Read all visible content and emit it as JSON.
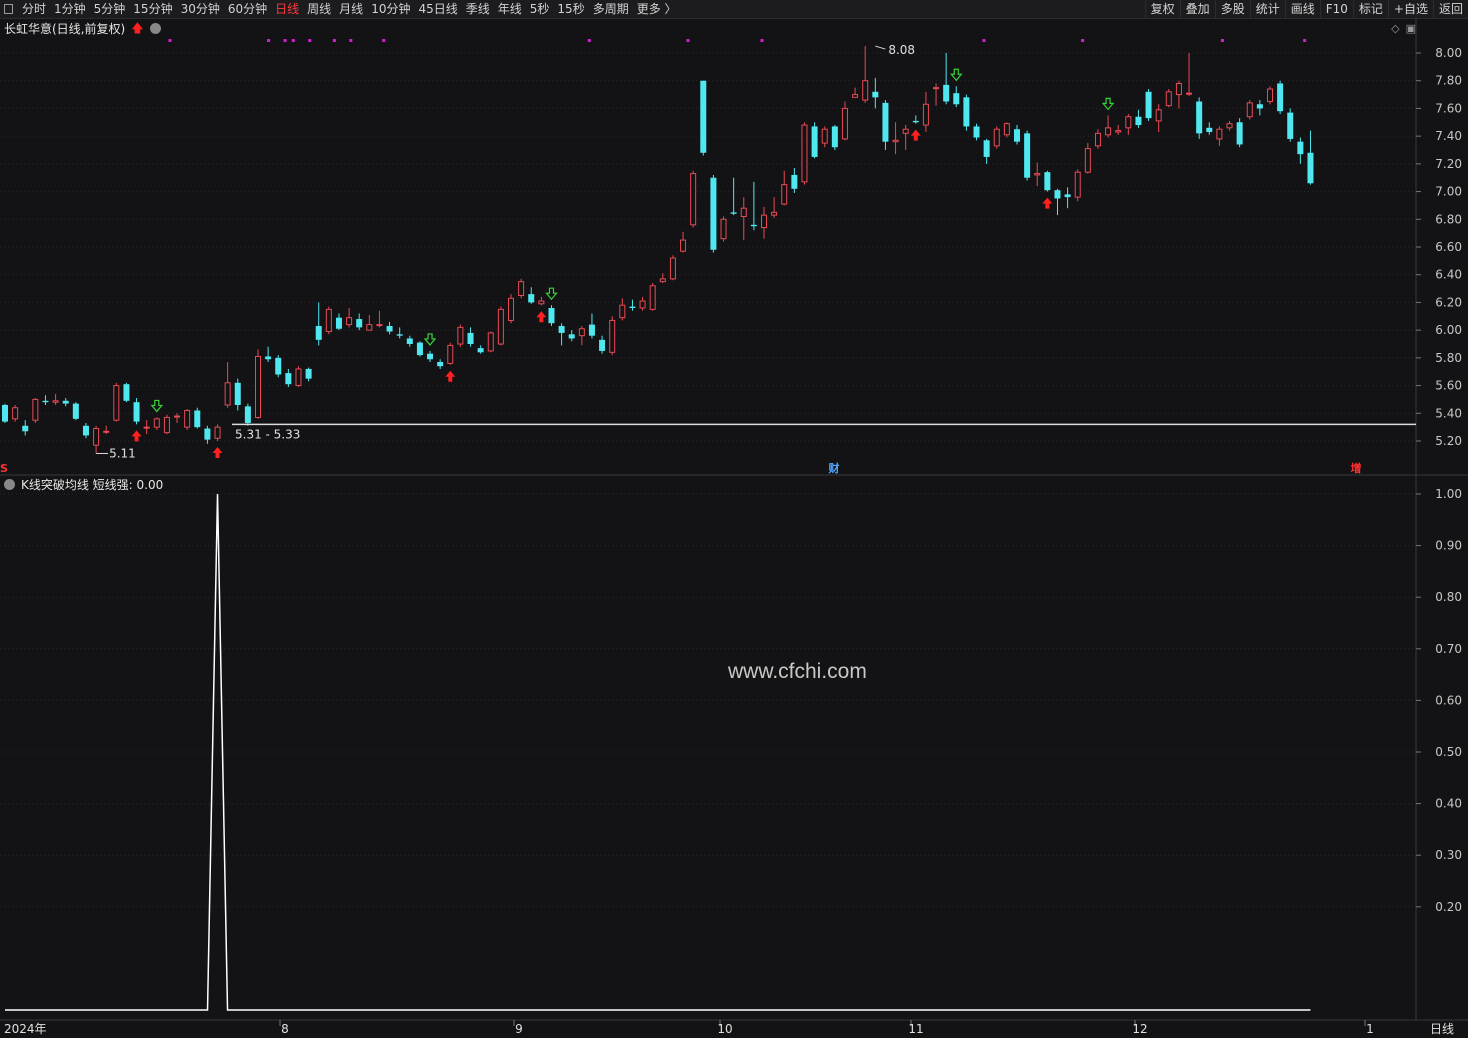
{
  "toolbar": {
    "periods": [
      "分时",
      "1分钟",
      "5分钟",
      "15分钟",
      "30分钟",
      "60分钟",
      "日线",
      "周线",
      "月线",
      "10分钟",
      "45日线",
      "季线",
      "年线",
      "5秒",
      "15秒",
      "多周期",
      "更多 〉"
    ],
    "active_period": "日线",
    "actions": [
      "复权",
      "叠加",
      "多股",
      "统计",
      "画线",
      "F10",
      "标记",
      "+自选",
      "返回"
    ]
  },
  "chart": {
    "title": "长虹华意(日线,前复权)",
    "high_label": "8.08",
    "low_label": "5.11",
    "range_label": "5.31 - 5.33",
    "event_markers": [
      "S",
      "财",
      "增"
    ],
    "price_ticks": [
      "8.00",
      "7.80",
      "7.60",
      "7.40",
      "7.20",
      "7.00",
      "6.80",
      "6.60",
      "6.40",
      "6.20",
      "6.00",
      "5.80",
      "5.60",
      "5.40",
      "5.20"
    ],
    "colors": {
      "up": "#e84a55",
      "down": "#4fe8f0",
      "background": "#131315",
      "grid": "#2a2a2e",
      "buy": "#ff2020",
      "sell": "#3ad23a",
      "dot": "#d020d0"
    }
  },
  "indicator": {
    "title": "K线突破均线 短线强: 0.00",
    "ticks": [
      "1.00",
      "0.90",
      "0.80",
      "0.70",
      "0.60",
      "0.50",
      "0.40",
      "0.30",
      "0.20"
    ]
  },
  "x_axis": {
    "labels": [
      "2024年",
      "8",
      "9",
      "10",
      "11",
      "12",
      "1"
    ],
    "period_label": "日线"
  },
  "watermark": "www.cfchi.com",
  "chart_data": {
    "type": "candlestick",
    "price_range": [
      5.1,
      8.1
    ],
    "candles": [
      [
        5.46,
        5.34,
        5.47,
        5.33
      ],
      [
        5.36,
        5.44,
        5.46,
        5.34
      ],
      [
        5.31,
        5.27,
        5.35,
        5.24
      ],
      [
        5.35,
        5.5,
        5.51,
        5.33
      ],
      [
        5.49,
        5.48,
        5.53,
        5.46
      ],
      [
        5.48,
        5.49,
        5.54,
        5.46
      ],
      [
        5.49,
        5.47,
        5.51,
        5.45
      ],
      [
        5.47,
        5.36,
        5.48,
        5.35
      ],
      [
        5.31,
        5.24,
        5.33,
        5.22
      ],
      [
        5.17,
        5.29,
        5.31,
        5.11
      ],
      [
        5.27,
        5.27,
        5.31,
        5.25
      ],
      [
        5.35,
        5.6,
        5.62,
        5.34
      ],
      [
        5.61,
        5.49,
        5.62,
        5.48
      ],
      [
        5.48,
        5.34,
        5.51,
        5.32
      ],
      [
        5.3,
        5.3,
        5.35,
        5.25
      ],
      [
        5.3,
        5.36,
        5.37,
        5.28
      ],
      [
        5.26,
        5.37,
        5.39,
        5.25
      ],
      [
        5.38,
        5.38,
        5.4,
        5.33
      ],
      [
        5.3,
        5.42,
        5.43,
        5.28
      ],
      [
        5.42,
        5.3,
        5.44,
        5.29
      ],
      [
        5.29,
        5.21,
        5.31,
        5.18
      ],
      [
        5.22,
        5.3,
        5.32,
        5.2
      ],
      [
        5.46,
        5.62,
        5.77,
        5.44
      ],
      [
        5.62,
        5.46,
        5.65,
        5.42
      ],
      [
        5.45,
        5.33,
        5.47,
        5.31
      ],
      [
        5.37,
        5.81,
        5.86,
        5.36
      ],
      [
        5.81,
        5.79,
        5.88,
        5.77
      ],
      [
        5.8,
        5.68,
        5.82,
        5.66
      ],
      [
        5.69,
        5.61,
        5.72,
        5.59
      ],
      [
        5.6,
        5.72,
        5.74,
        5.59
      ],
      [
        5.72,
        5.65,
        5.73,
        5.63
      ],
      [
        6.03,
        5.93,
        6.2,
        5.89
      ],
      [
        5.99,
        6.15,
        6.17,
        5.97
      ],
      [
        6.09,
        6.01,
        6.12,
        6.0
      ],
      [
        6.04,
        6.09,
        6.16,
        6.02
      ],
      [
        6.08,
        6.02,
        6.12,
        6.0
      ],
      [
        6.0,
        6.04,
        6.11,
        6.01
      ],
      [
        6.04,
        6.04,
        6.14,
        6.02
      ],
      [
        6.03,
        5.99,
        6.06,
        5.97
      ],
      [
        5.97,
        5.96,
        6.02,
        5.94
      ],
      [
        5.94,
        5.9,
        5.96,
        5.88
      ],
      [
        5.91,
        5.82,
        5.92,
        5.81
      ],
      [
        5.83,
        5.79,
        5.85,
        5.77
      ],
      [
        5.77,
        5.74,
        5.79,
        5.72
      ],
      [
        5.76,
        5.89,
        5.91,
        5.75
      ],
      [
        5.9,
        6.02,
        6.04,
        5.88
      ],
      [
        5.98,
        5.9,
        6.02,
        5.88
      ],
      [
        5.87,
        5.84,
        5.89,
        5.83
      ],
      [
        5.85,
        5.98,
        5.99,
        5.84
      ],
      [
        5.9,
        6.15,
        6.17,
        5.89
      ],
      [
        6.07,
        6.23,
        6.26,
        6.05
      ],
      [
        6.25,
        6.35,
        6.37,
        6.23
      ],
      [
        6.26,
        6.2,
        6.31,
        6.19
      ],
      [
        6.19,
        6.21,
        6.24,
        6.18
      ],
      [
        6.16,
        6.05,
        6.18,
        6.03
      ],
      [
        6.03,
        5.98,
        6.05,
        5.89
      ],
      [
        5.97,
        5.94,
        6.0,
        5.92
      ],
      [
        5.96,
        6.01,
        6.03,
        5.89
      ],
      [
        6.04,
        5.96,
        6.12,
        5.94
      ],
      [
        5.93,
        5.85,
        5.96,
        5.83
      ],
      [
        5.84,
        6.07,
        6.1,
        5.82
      ],
      [
        6.09,
        6.18,
        6.23,
        6.07
      ],
      [
        6.17,
        6.16,
        6.22,
        6.14
      ],
      [
        6.16,
        6.21,
        6.24,
        6.14
      ],
      [
        6.15,
        6.32,
        6.34,
        6.14
      ],
      [
        6.35,
        6.37,
        6.41,
        6.34
      ],
      [
        6.37,
        6.52,
        6.54,
        6.36
      ],
      [
        6.57,
        6.65,
        6.71,
        6.56
      ],
      [
        6.76,
        7.13,
        7.15,
        6.74
      ],
      [
        7.8,
        7.28,
        7.8,
        7.26
      ],
      [
        7.1,
        6.58,
        7.12,
        6.56
      ],
      [
        6.66,
        6.8,
        6.82,
        6.64
      ],
      [
        6.85,
        6.84,
        7.1,
        6.83
      ],
      [
        6.82,
        6.88,
        6.96,
        6.65
      ],
      [
        6.76,
        6.75,
        7.07,
        6.72
      ],
      [
        6.74,
        6.83,
        6.89,
        6.66
      ],
      [
        6.83,
        6.85,
        6.96,
        6.81
      ],
      [
        6.91,
        7.05,
        7.15,
        6.9
      ],
      [
        7.12,
        7.02,
        7.17,
        6.99
      ],
      [
        7.07,
        7.48,
        7.5,
        7.05
      ],
      [
        7.47,
        7.25,
        7.5,
        7.24
      ],
      [
        7.35,
        7.45,
        7.47,
        7.32
      ],
      [
        7.47,
        7.32,
        7.48,
        7.3
      ],
      [
        7.38,
        7.6,
        7.65,
        7.37
      ],
      [
        7.68,
        7.7,
        7.75,
        7.68
      ],
      [
        7.66,
        7.8,
        8.05,
        7.64
      ],
      [
        7.72,
        7.68,
        7.82,
        7.6
      ],
      [
        7.64,
        7.36,
        7.66,
        7.3
      ],
      [
        7.36,
        7.37,
        7.5,
        7.27
      ],
      [
        7.42,
        7.45,
        7.48,
        7.3
      ],
      [
        7.51,
        7.5,
        7.55,
        7.49
      ],
      [
        7.48,
        7.63,
        7.72,
        7.43
      ],
      [
        7.75,
        7.75,
        7.78,
        7.62
      ],
      [
        7.77,
        7.65,
        8.0,
        7.63
      ],
      [
        7.71,
        7.63,
        7.76,
        7.61
      ],
      [
        7.68,
        7.47,
        7.7,
        7.44
      ],
      [
        7.47,
        7.39,
        7.49,
        7.37
      ],
      [
        7.37,
        7.25,
        7.38,
        7.2
      ],
      [
        7.33,
        7.45,
        7.47,
        7.31
      ],
      [
        7.41,
        7.49,
        7.5,
        7.39
      ],
      [
        7.45,
        7.36,
        7.48,
        7.34
      ],
      [
        7.42,
        7.1,
        7.44,
        7.08
      ],
      [
        7.12,
        7.13,
        7.21,
        7.04
      ],
      [
        7.14,
        7.01,
        7.15,
        7.0
      ],
      [
        7.01,
        6.95,
        7.02,
        6.83
      ],
      [
        6.98,
        6.96,
        7.03,
        6.88
      ],
      [
        6.96,
        7.14,
        7.16,
        6.93
      ],
      [
        7.14,
        7.31,
        7.35,
        7.13
      ],
      [
        7.33,
        7.42,
        7.45,
        7.31
      ],
      [
        7.41,
        7.46,
        7.55,
        7.39
      ],
      [
        7.43,
        7.44,
        7.48,
        7.41
      ],
      [
        7.46,
        7.54,
        7.56,
        7.41
      ],
      [
        7.54,
        7.48,
        7.59,
        7.46
      ],
      [
        7.72,
        7.53,
        7.74,
        7.51
      ],
      [
        7.51,
        7.59,
        7.63,
        7.43
      ],
      [
        7.62,
        7.72,
        7.74,
        7.61
      ],
      [
        7.7,
        7.78,
        7.8,
        7.6
      ],
      [
        7.71,
        7.71,
        8.0,
        7.69
      ],
      [
        7.65,
        7.42,
        7.68,
        7.38
      ],
      [
        7.46,
        7.43,
        7.5,
        7.41
      ],
      [
        7.38,
        7.45,
        7.47,
        7.33
      ],
      [
        7.46,
        7.49,
        7.51,
        7.44
      ],
      [
        7.5,
        7.34,
        7.53,
        7.32
      ],
      [
        7.54,
        7.64,
        7.66,
        7.52
      ],
      [
        7.63,
        7.6,
        7.66,
        7.55
      ],
      [
        7.65,
        7.74,
        7.76,
        7.63
      ],
      [
        7.78,
        7.58,
        7.8,
        7.56
      ],
      [
        7.57,
        7.38,
        7.6,
        7.36
      ],
      [
        7.36,
        7.27,
        7.39,
        7.2
      ],
      [
        7.28,
        7.06,
        7.44,
        7.05
      ]
    ],
    "buy_signals": [
      13,
      21,
      44,
      53,
      90,
      103
    ],
    "sell_signals": [
      15,
      42,
      54,
      94,
      109
    ],
    "indicator_line": {
      "peak_index": 21,
      "peak_value": 1.0,
      "baseline": 0.0
    }
  }
}
